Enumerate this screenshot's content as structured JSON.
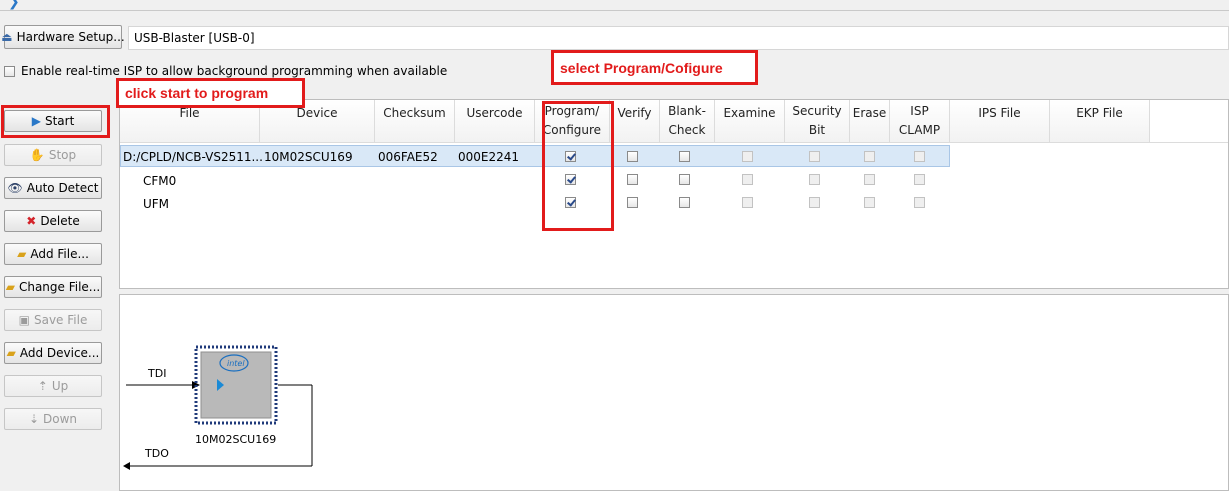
{
  "toolbar": {
    "hardware_setup_label": "Hardware Setup...",
    "hardware_value": "USB-Blaster [USB-0]",
    "isp_label": "Enable real-time ISP to allow background programming when available",
    "isp_checked": false
  },
  "sidebar": {
    "start": "Start",
    "stop": "Stop",
    "auto_detect": "Auto Detect",
    "delete": "Delete",
    "add_file": "Add File...",
    "change_file": "Change File...",
    "save_file": "Save File",
    "add_device": "Add Device...",
    "up": "Up",
    "down": "Down"
  },
  "table": {
    "headers": {
      "file": "File",
      "device": "Device",
      "checksum": "Checksum",
      "usercode": "Usercode",
      "program_1": "Program/",
      "program_2": "Configure",
      "verify": "Verify",
      "blank_1": "Blank-",
      "blank_2": "Check",
      "examine": "Examine",
      "security_1": "Security",
      "security_2": "Bit",
      "erase": "Erase",
      "isp_1": "ISP",
      "isp_2": "CLAMP",
      "ips_file": "IPS File",
      "ekp_file": "EKP File"
    },
    "rows": [
      {
        "file": "D:/CPLD/NCB-VS2511...",
        "device": "10M02SCU169",
        "checksum": "006FAE52",
        "usercode": "000E2241",
        "program": true,
        "verify": false,
        "blank": false
      },
      {
        "file": "CFM0",
        "device": "",
        "checksum": "",
        "usercode": "",
        "program": true,
        "verify": false,
        "blank": false
      },
      {
        "file": "UFM",
        "device": "",
        "checksum": "",
        "usercode": "",
        "program": true,
        "verify": false,
        "blank": false
      }
    ]
  },
  "chain": {
    "tdi": "TDI",
    "tdo": "TDO",
    "device_name": "10M02SCU169",
    "logo": "intel"
  },
  "annotations": {
    "start": "click start to program",
    "program": "select Program/Cofigure"
  },
  "colors": {
    "callout": "#e21b1b",
    "selection": "#d9e8f7",
    "chip": "#b9b9b9"
  }
}
